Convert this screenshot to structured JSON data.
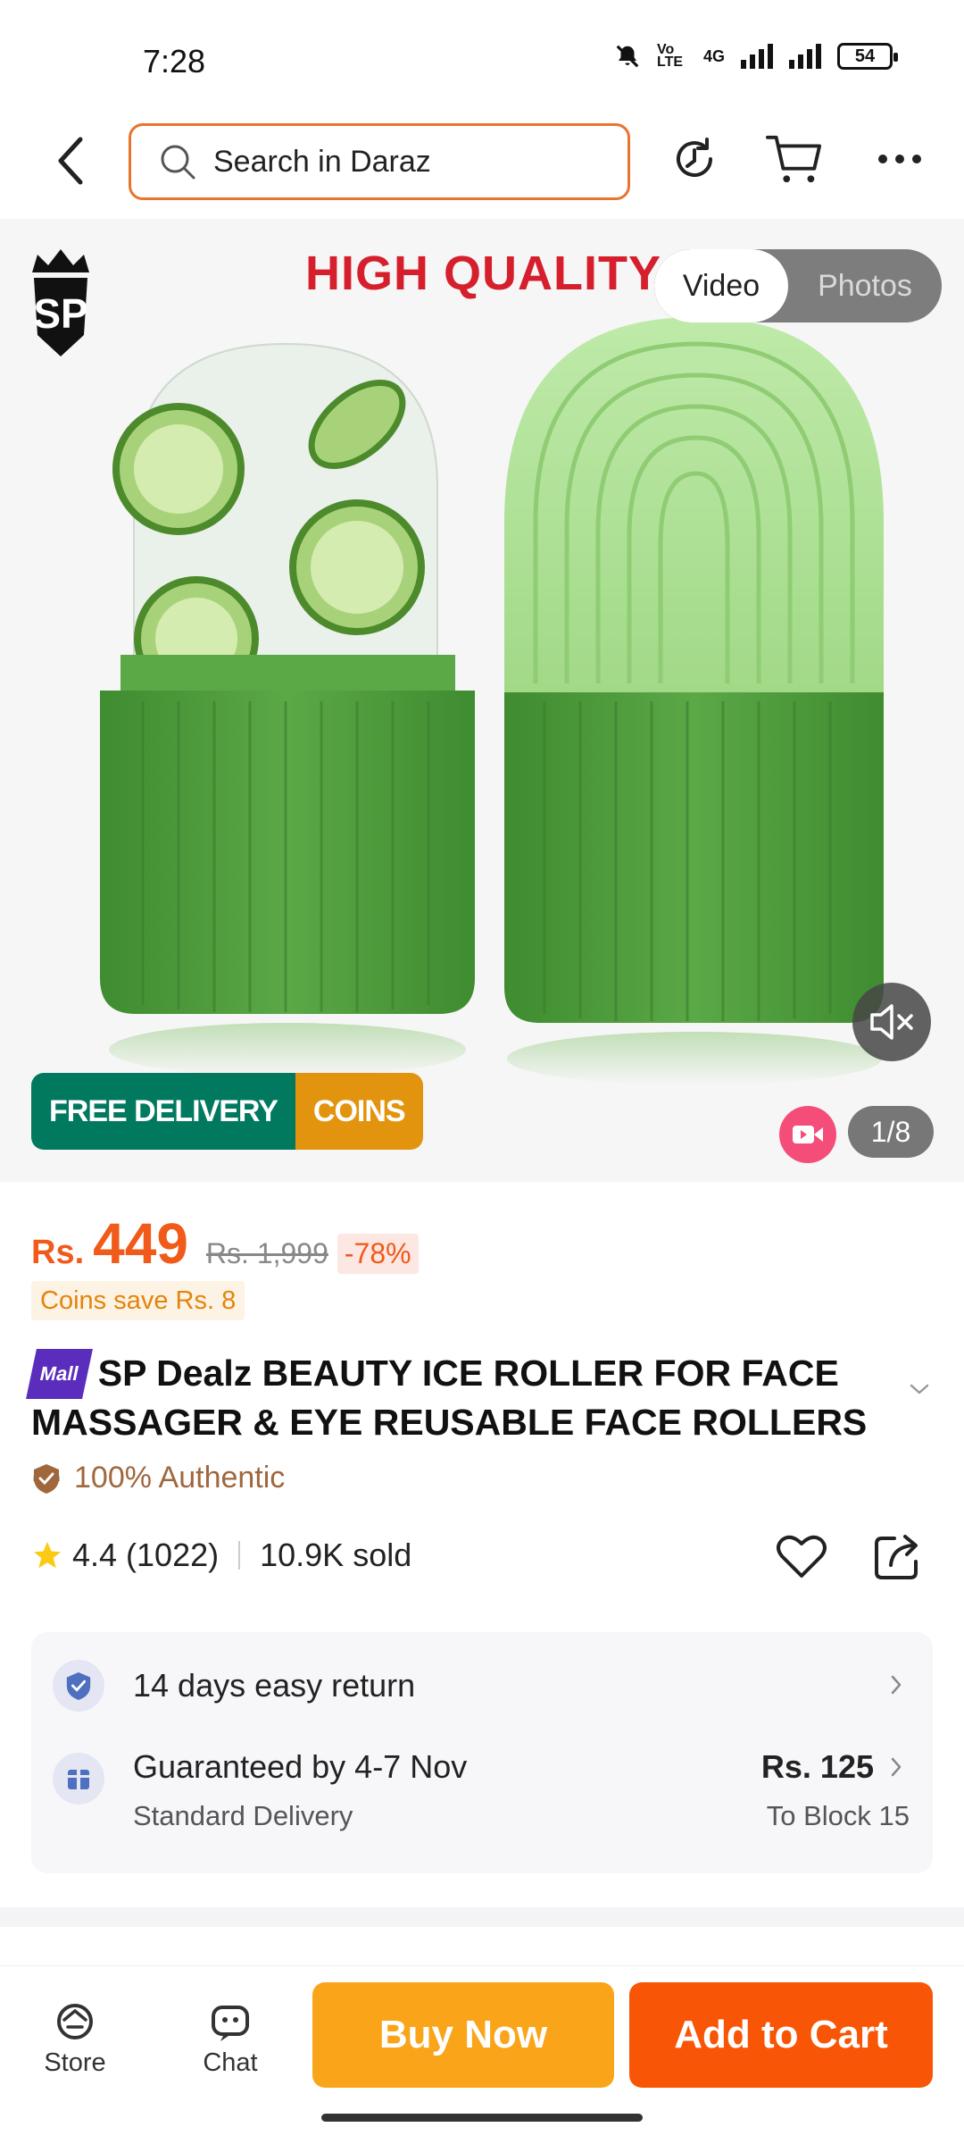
{
  "status": {
    "time": "7:28",
    "volte": "Vo LTE",
    "network": "4G",
    "battery": "54"
  },
  "header": {
    "search_placeholder": "Search in Daraz"
  },
  "gallery": {
    "banner_text": "HIGH QUALITY",
    "logo_text": "SP",
    "tabs": [
      "Video",
      "Photos"
    ],
    "free_delivery_label": "FREE DELIVERY",
    "coins_label": "COINS",
    "counter": "1/8",
    "product_colors": {
      "dark_green": "#4f9a3c",
      "light_green": "#a6dc8c"
    }
  },
  "product": {
    "currency": "Rs.",
    "price": "449",
    "original_price": "Rs. 1,999",
    "discount": "-78%",
    "coins_save": "Coins save Rs. 8",
    "mall_badge": "Mall",
    "title": "SP Dealz  BEAUTY ICE ROLLER FOR FACE MASSAGER & EYE REUSABLE FACE ROLLERS ...",
    "authentic": "100% Authentic",
    "rating": "4.4",
    "rating_count": "(1022)",
    "sold": "10.9K sold"
  },
  "services": {
    "return_text": "14 days easy return",
    "delivery_title": "Guaranteed by 4-7 Nov",
    "delivery_type": "Standard Delivery",
    "delivery_price": "Rs. 125",
    "delivery_location": "To Block 15"
  },
  "bottom": {
    "store_label": "Store",
    "chat_label": "Chat",
    "buy_now": "Buy Now",
    "add_to_cart": "Add to Cart"
  },
  "colors": {
    "accent": "#f85606",
    "buy_now": "#faa41a",
    "free_delivery": "#00795f",
    "coins": "#e3940e"
  }
}
